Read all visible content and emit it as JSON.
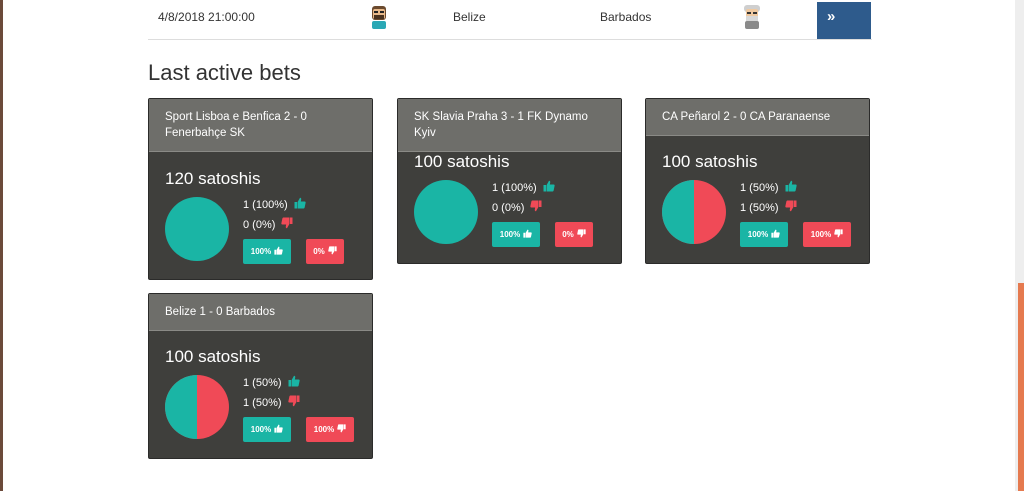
{
  "match": {
    "date": "4/8/2018 21:00:00",
    "team_a": "Belize",
    "team_b": "Barbados",
    "go_label": "»"
  },
  "section_title": "Last active bets",
  "colors": {
    "up": "#1ab5a5",
    "down": "#f04a57",
    "card": "#3f3f3c",
    "header": "#6e6e6a",
    "go": "#2e5b8c"
  },
  "bets": [
    {
      "title": "Sport Lisboa e Benfica 2 - 0 Fenerbahçe SK",
      "amount": "120 satoshis",
      "up_stat": "1 (100%)",
      "down_stat": "0 (0%)",
      "up_btn": "100%",
      "down_btn": "0%",
      "up_share": 1.0
    },
    {
      "title": "SK Slavia Praha 3 - 1 FK Dynamo Kyiv",
      "amount": "100 satoshis",
      "up_stat": "1 (100%)",
      "down_stat": "0 (0%)",
      "up_btn": "100%",
      "down_btn": "0%",
      "up_share": 1.0
    },
    {
      "title": "CA Peñarol 2 - 0 CA Paranaense",
      "amount": "100 satoshis",
      "up_stat": "1 (50%)",
      "down_stat": "1 (50%)",
      "up_btn": "100%",
      "down_btn": "100%",
      "up_share": 0.5
    },
    {
      "title": "Belize 1 - 0 Barbados",
      "amount": "100 satoshis",
      "up_stat": "1 (50%)",
      "down_stat": "1 (50%)",
      "up_btn": "100%",
      "down_btn": "100%",
      "up_share": 0.5
    }
  ]
}
